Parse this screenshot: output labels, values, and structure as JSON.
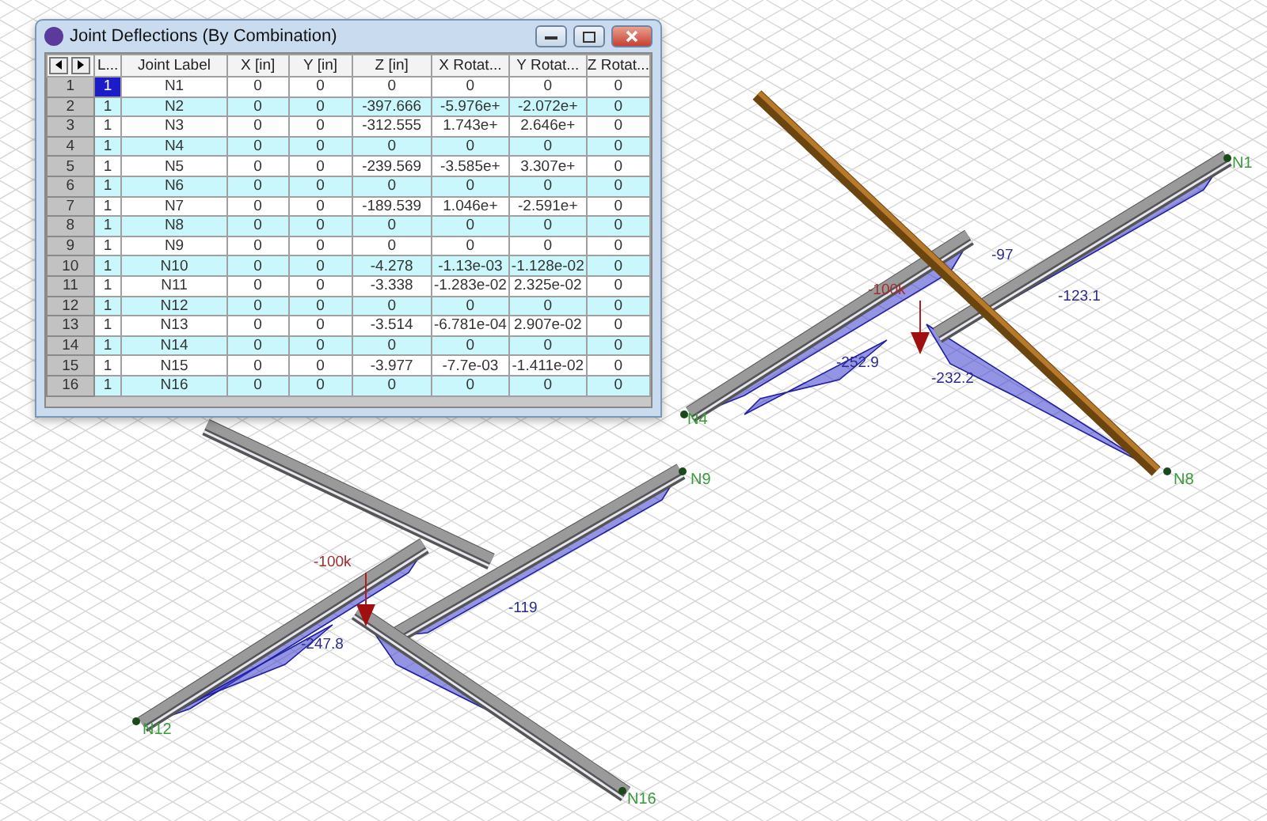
{
  "window": {
    "title": "Joint Deflections (By Combination)"
  },
  "table": {
    "columns": [
      "L...",
      "Joint Label",
      "X [in]",
      "Y [in]",
      "Z [in]",
      "X Rotat...",
      "Y Rotat...",
      "Z Rotat..."
    ],
    "rows": [
      {
        "number": "1",
        "selected": true,
        "cells": [
          "1",
          "N1",
          "0",
          "0",
          "0",
          "0",
          "0",
          "0"
        ]
      },
      {
        "number": "2",
        "selected": false,
        "cells": [
          "1",
          "N2",
          "0",
          "0",
          "-397.666",
          "-5.976e+",
          "-2.072e+",
          "0"
        ]
      },
      {
        "number": "3",
        "selected": false,
        "cells": [
          "1",
          "N3",
          "0",
          "0",
          "-312.555",
          "1.743e+",
          "2.646e+",
          "0"
        ]
      },
      {
        "number": "4",
        "selected": false,
        "cells": [
          "1",
          "N4",
          "0",
          "0",
          "0",
          "0",
          "0",
          "0"
        ]
      },
      {
        "number": "5",
        "selected": false,
        "cells": [
          "1",
          "N5",
          "0",
          "0",
          "-239.569",
          "-3.585e+",
          "3.307e+",
          "0"
        ]
      },
      {
        "number": "6",
        "selected": false,
        "cells": [
          "1",
          "N6",
          "0",
          "0",
          "0",
          "0",
          "0",
          "0"
        ]
      },
      {
        "number": "7",
        "selected": false,
        "cells": [
          "1",
          "N7",
          "0",
          "0",
          "-189.539",
          "1.046e+",
          "-2.591e+",
          "0"
        ]
      },
      {
        "number": "8",
        "selected": false,
        "cells": [
          "1",
          "N8",
          "0",
          "0",
          "0",
          "0",
          "0",
          "0"
        ]
      },
      {
        "number": "9",
        "selected": false,
        "cells": [
          "1",
          "N9",
          "0",
          "0",
          "0",
          "0",
          "0",
          "0"
        ]
      },
      {
        "number": "10",
        "selected": false,
        "cells": [
          "1",
          "N10",
          "0",
          "0",
          "-4.278",
          "-1.13e-03",
          "-1.128e-02",
          "0"
        ]
      },
      {
        "number": "11",
        "selected": false,
        "cells": [
          "1",
          "N11",
          "0",
          "0",
          "-3.338",
          "-1.283e-02",
          "2.325e-02",
          "0"
        ]
      },
      {
        "number": "12",
        "selected": false,
        "cells": [
          "1",
          "N12",
          "0",
          "0",
          "0",
          "0",
          "0",
          "0"
        ]
      },
      {
        "number": "13",
        "selected": false,
        "cells": [
          "1",
          "N13",
          "0",
          "0",
          "-3.514",
          "-6.781e-04",
          "2.907e-02",
          "0"
        ]
      },
      {
        "number": "14",
        "selected": false,
        "cells": [
          "1",
          "N14",
          "0",
          "0",
          "0",
          "0",
          "0",
          "0"
        ]
      },
      {
        "number": "15",
        "selected": false,
        "cells": [
          "1",
          "N15",
          "0",
          "0",
          "-3.977",
          "-7.7e-03",
          "-1.411e-02",
          "0"
        ]
      },
      {
        "number": "16",
        "selected": false,
        "cells": [
          "1",
          "N16",
          "0",
          "0",
          "0",
          "0",
          "0",
          "0"
        ]
      }
    ]
  },
  "canvas": {
    "node_labels": [
      "N1",
      "N4",
      "N8",
      "N9",
      "N12",
      "N16"
    ],
    "load_labels": [
      "-100k",
      "-100k"
    ],
    "value_labels": [
      "-97",
      "-123.1",
      "-252.9",
      "-232.2",
      "-119",
      "-247.8"
    ]
  }
}
